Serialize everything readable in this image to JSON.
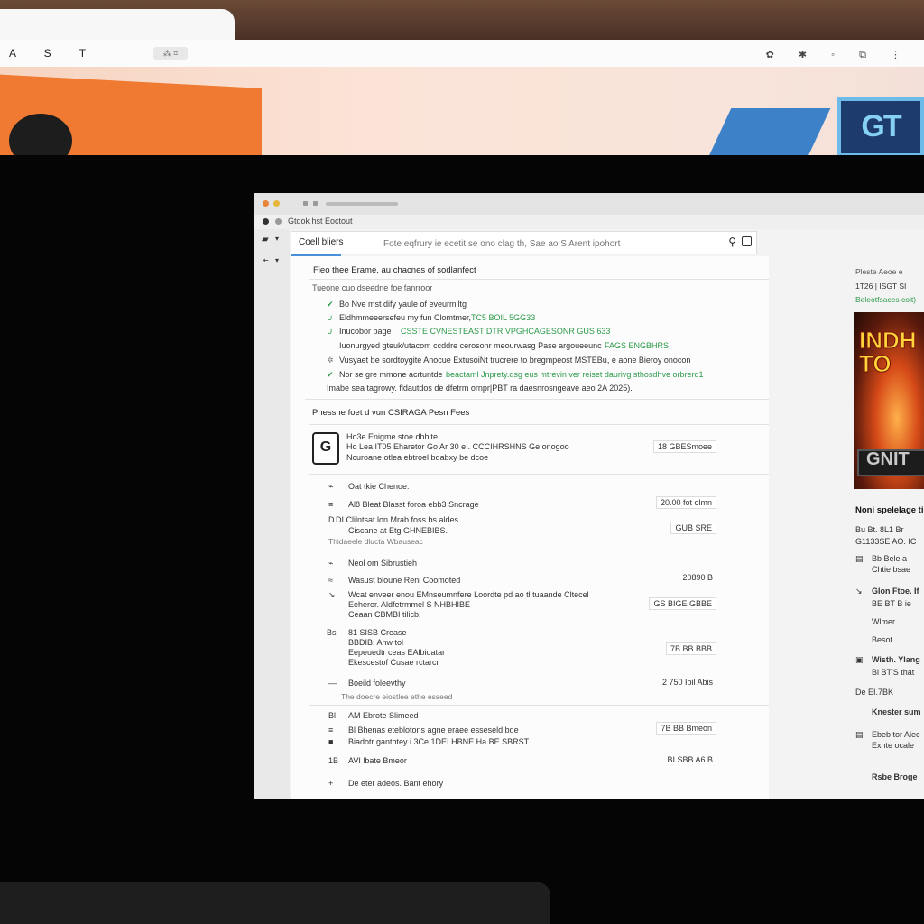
{
  "outer_browser": {
    "toolbar_letters": "A  S  T",
    "extension_label": "⁂ ⌗",
    "toolbar_icons": "✿ ✱ ◦ ⧉ ⋮",
    "banner_logo_text": "GT"
  },
  "inner_window": {
    "tab_title": "Gtdok hst Eoctout",
    "search": {
      "label": "Coell bliers",
      "placeholder": "Fote eqfrury ie ecetit se ono clag th, Sae ao S Arent ipohort"
    },
    "section_intro": {
      "title": "Fieo thee Erame, au chacnes of sodlanfect",
      "subtitle": "Tueone cuo dseedne foe fanrroor",
      "items": [
        {
          "text": "Bo Nve mst dify yaule of eveurmiltg",
          "green": ""
        },
        {
          "text": "Eldhmmeeersefeu my fun Clomtmer,",
          "green": "TC5 BOIL 5GG33"
        },
        {
          "text": "Inucobor page",
          "green": "CSSTE CVNESTEAST DTR VPGHCAGESONR GUS 633"
        },
        {
          "text": "Iuonurgyed gteuk/utacom ccddre cerosonr meourwasg Pase argoueeunc",
          "green": "FAGS ENGBHRS"
        },
        {
          "text": "Vusyaet be sordtoygite Anocue ExtusoiNt trucrere to bregmpeost MSTEBu, e aone Bieroy onocon",
          "green": ""
        },
        {
          "text": "Nor se gre mmone acrtuntde",
          "green": "beactaml Jnprety.dsg eus mtrevin ver reiset daurivg sthosdhve orbrerd1"
        },
        {
          "text": "Imabe sea tagrowy. fldautdos de dfetrm ornpr|PBT ra daesnrosngeave aeo 2A 2025).",
          "green": ""
        }
      ]
    },
    "section_main": {
      "title": "Pnesshe foet d vun CSIRAGA Pesn Fees",
      "app_row": {
        "name": "Ho3e Enigme stoe dhhite",
        "desc1": "Ho Lea IT05 Eharetor Go Ar 30 e.. CCCIHRSHNS Ge onogoo",
        "desc2": "Ncuroane otlea ebtroel bdabxy be dcoe",
        "value": "18 GBESmoee",
        "logo": "G"
      },
      "groups": [
        {
          "header": "Oat tkie Chenoe:",
          "rows": [
            {
              "icon": "≡",
              "text": "Al8 Bleat Blasst foroa ebb3 Sncrage",
              "value": "20.00 fot olmn"
            },
            {
              "icon": "D",
              "text": "DI Clilntsat lon Mrab foss bs aldes",
              "text2": "Ciscane at Etg GHNEBIBS.",
              "value": "GUB SRE"
            }
          ],
          "footer": "Thidaeele dlucta Wbauseac"
        },
        {
          "header": "Neol om Sibrustieh",
          "rows": [
            {
              "icon": "≈",
              "text": "Wasust bloune Reni Coomoted",
              "value": "20890 B"
            },
            {
              "icon": "↘",
              "text": "Wcat enveer enou EMnseumnfere Loordte pd ao tl tuaande Cltecel",
              "text2": "Eeherer. Aldfetrmmel S NHBHIBE",
              "text3": "Ceaan CBMBI tilicb.",
              "value": "GS BIGE GBBE"
            },
            {
              "icon": "Bs",
              "text": "81 SISB Crease",
              "text2": "BBDIB: Anw tol",
              "text3": "Eepeuedtr ceas EAlbidatar",
              "text4": "Ekescestof Cusae rctarcr",
              "value": "7B.BB BBB"
            },
            {
              "icon": "—",
              "text": "Boeild foleevthy",
              "value": "2 750 Ibil Abis"
            }
          ],
          "footer": "The doecre eiostlee ethe esseed"
        },
        {
          "header": "",
          "rows": [
            {
              "icon": "Bl",
              "text": "AM Ebrote Slimeed",
              "value": ""
            },
            {
              "icon": "≡",
              "text": "Bl Bhenas eteblotons agne eraee esseseld bde",
              "value": "7B BB Bmeon"
            },
            {
              "icon": "■",
              "text": "Biadotr ganthtey i 3Ce 1DELHBNE Ha BE SBRST",
              "value": ""
            },
            {
              "icon": "1B",
              "text": "AVI lbate Bmeor",
              "value": "BI.SBB A6 B"
            },
            {
              "icon": "+",
              "text": "De eter adeos. Bant ehory",
              "value": ""
            }
          ]
        }
      ]
    },
    "right_panel": {
      "line1": "Pleste Aeoe e",
      "line2": "1T26 | ISGT SI",
      "line3": "Beleotfsaces coit)",
      "poster_title": "INDH TO",
      "poster_band": "GNIT",
      "heading": "Noni spelelage ti",
      "para1": "Bu Bt. 8L1 Br",
      "para2": "G1133SE AO. IC",
      "items": [
        "Bb Bele a",
        "Chtie bsae",
        "Glon Ftoe. If",
        "BE BT B ie",
        "Wlmer",
        "Besot",
        "Wisth. Ylang",
        "Bl BT'S that",
        "De EI.7BK",
        "Knester sum",
        "Ebeb tor Alec",
        "Exnte ocale",
        "Rsbe Broge"
      ]
    }
  }
}
